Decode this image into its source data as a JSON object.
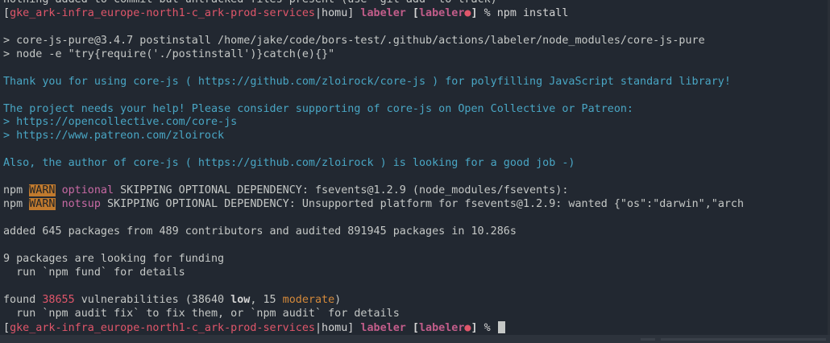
{
  "prompt": {
    "prefix": "gke_ark-infra_europe-north1-c_ark-prod-services",
    "sep": "|",
    "user": "homu",
    "dir": "labeler",
    "branch": "labeler",
    "dirty_mark": "●",
    "symbol": "%"
  },
  "lines": {
    "l0": "nothing added to commit but untracked files present (use \"git add\" to track)",
    "l1_cmd": "npm install",
    "l2": "",
    "l3": "> core-js-pure@3.4.7 postinstall /home/jake/code/bors-test/.github/actions/labeler/node_modules/core-js-pure",
    "l4": "> node -e \"try{require('./postinstall')}catch(e){}\"",
    "l5": "",
    "l6": "Thank you for using core-js ( https://github.com/zloirock/core-js ) for polyfilling JavaScript standard library!",
    "l7": "",
    "l8": "The project needs your help! Please consider supporting of core-js on Open Collective or Patreon:",
    "l9": "> https://opencollective.com/core-js",
    "l10": "> https://www.patreon.com/zloirock",
    "l11": "",
    "l12": "Also, the author of core-js ( https://github.com/zloirock ) is looking for a good job -)",
    "l13": "",
    "warn1": {
      "npm": "npm ",
      "warn": "WARN",
      "tag": "optional",
      "rest": " SKIPPING OPTIONAL DEPENDENCY: fsevents@1.2.9 (node_modules/fsevents):"
    },
    "warn2": {
      "npm": "npm ",
      "warn": "WARN",
      "tag": "notsup",
      "rest": " SKIPPING OPTIONAL DEPENDENCY: Unsupported platform for fsevents@1.2.9: wanted {\"os\":\"darwin\",\"arch"
    },
    "l16": "",
    "l17": "added 645 packages from 489 contributors and audited 891945 packages in 10.286s",
    "l18": "",
    "l19": "9 packages are looking for funding",
    "l20": "  run `npm fund` for details",
    "l21": "",
    "found": {
      "a": "found ",
      "count": "38655",
      "b": " vulnerabilities (38640 ",
      "low": "low",
      "c": ", 15 ",
      "moderate": "moderate",
      "d": ")"
    },
    "l23": "  run `npm audit fix` to fix them, or `npm audit` for details"
  },
  "colors": {
    "background": "#222831",
    "text": "#c5c8c6",
    "cyan": "#49a6c4",
    "prompt_red": "#e0566a",
    "warn_bg": "#c07a2e"
  },
  "icons": {
    "cursor": "block-cursor-icon"
  }
}
